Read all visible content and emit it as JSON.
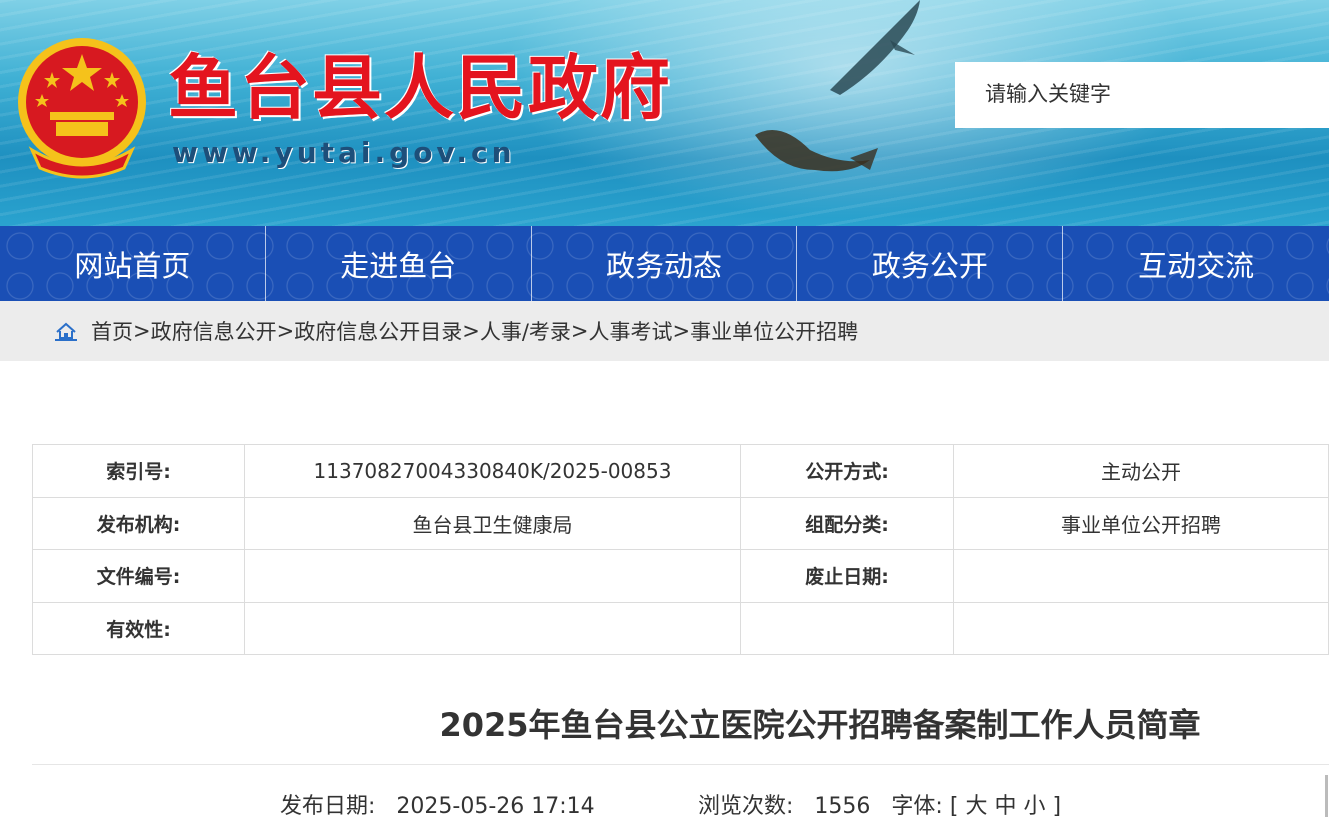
{
  "header": {
    "title": "鱼台县人民政府",
    "url": "www.yutai.gov.cn",
    "search_placeholder": "请输入关键字"
  },
  "nav": {
    "items": [
      {
        "label": "网站首页"
      },
      {
        "label": "走进鱼台"
      },
      {
        "label": "政务动态"
      },
      {
        "label": "政务公开"
      },
      {
        "label": "互动交流"
      }
    ]
  },
  "breadcrumb": {
    "items": [
      "首页",
      "政府信息公开",
      "政府信息公开目录",
      "人事/考录",
      "人事考试",
      "事业单位公开招聘"
    ],
    "separator": ">"
  },
  "meta": {
    "index_no_label": "索引号:",
    "index_no_value": "11370827004330840K/2025-00853",
    "disclosure_label": "公开方式:",
    "disclosure_value": "主动公开",
    "publisher_label": "发布机构:",
    "publisher_value": "鱼台县卫生健康局",
    "category_label": "组配分类:",
    "category_value": "事业单位公开招聘",
    "doc_no_label": "文件编号:",
    "doc_no_value": "",
    "expiry_label": "废止日期:",
    "expiry_value": "",
    "validity_label": "有效性:",
    "validity_value": ""
  },
  "article": {
    "title": "2025年鱼台县公立医院公开招聘备案制工作人员简章",
    "publish_label": "发布日期:",
    "publish_date": "2025-05-26 17:14",
    "views_label": "浏览次数:",
    "views": "1556",
    "font_label": "字体:",
    "font_open": "[",
    "font_large": "大",
    "font_medium": "中",
    "font_small": "小",
    "font_close": "]"
  },
  "colors": {
    "title_red": "#e4141e",
    "nav_blue": "#1a4fb5",
    "breadcrumb_bg": "#ececec"
  }
}
